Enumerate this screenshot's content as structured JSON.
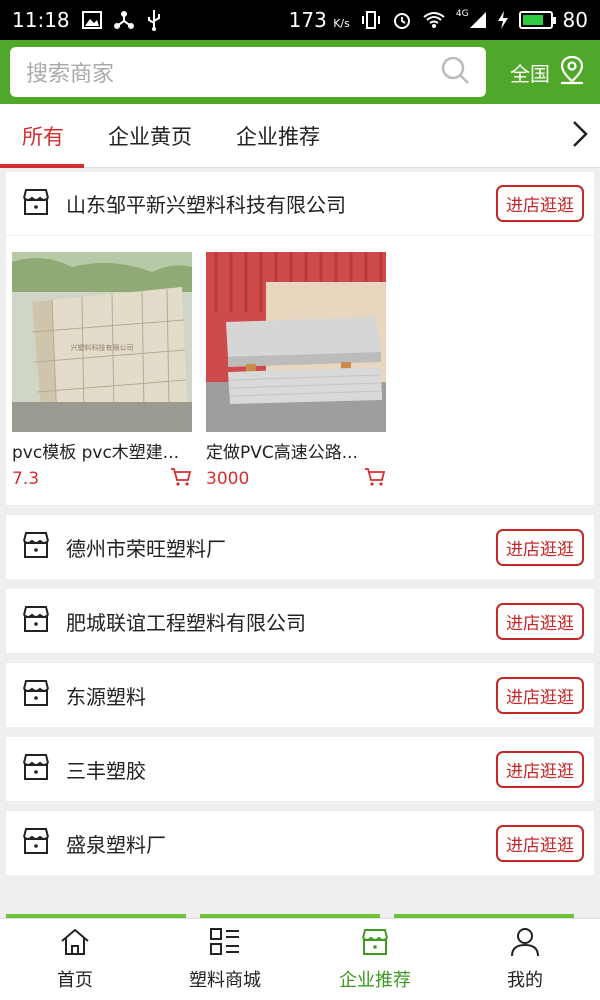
{
  "status_bar": {
    "time": "11:18",
    "speed": "173",
    "speed_unit": "K/s",
    "network": "4G",
    "battery": "80",
    "battery_fraction": 0.8,
    "icons": [
      "image-icon",
      "usb-share-icon",
      "usb-icon",
      "vibrate-icon",
      "alarm-icon",
      "wifi-icon",
      "signal-icon",
      "charging-icon"
    ]
  },
  "header": {
    "search_placeholder": "搜索商家",
    "region_label": "全国",
    "accent_color": "#4fa82a"
  },
  "tabs": {
    "items": [
      {
        "label": "所有",
        "active": true
      },
      {
        "label": "企业黄页",
        "active": false
      },
      {
        "label": "企业推荐",
        "active": false
      }
    ]
  },
  "stores": [
    {
      "name": "山东邹平新兴塑料科技有限公司",
      "button": "进店逛逛",
      "products": [
        {
          "name": "pvc模板 pvc木塑建...",
          "price": "7.3"
        },
        {
          "name": "定做PVC高速公路...",
          "price": "3000"
        }
      ]
    },
    {
      "name": "德州市荣旺塑料厂",
      "button": "进店逛逛"
    },
    {
      "name": "肥城联谊工程塑料有限公司",
      "button": "进店逛逛"
    },
    {
      "name": "东源塑料",
      "button": "进店逛逛"
    },
    {
      "name": "三丰塑胶",
      "button": "进店逛逛"
    },
    {
      "name": "盛泉塑料厂",
      "button": "进店逛逛"
    }
  ],
  "bottom_nav": {
    "items": [
      {
        "label": "首页",
        "icon": "home-icon"
      },
      {
        "label": "塑料商城",
        "icon": "grid-list-icon"
      },
      {
        "label": "企业推荐",
        "icon": "store-icon",
        "active": true
      },
      {
        "label": "我的",
        "icon": "user-icon"
      }
    ]
  }
}
